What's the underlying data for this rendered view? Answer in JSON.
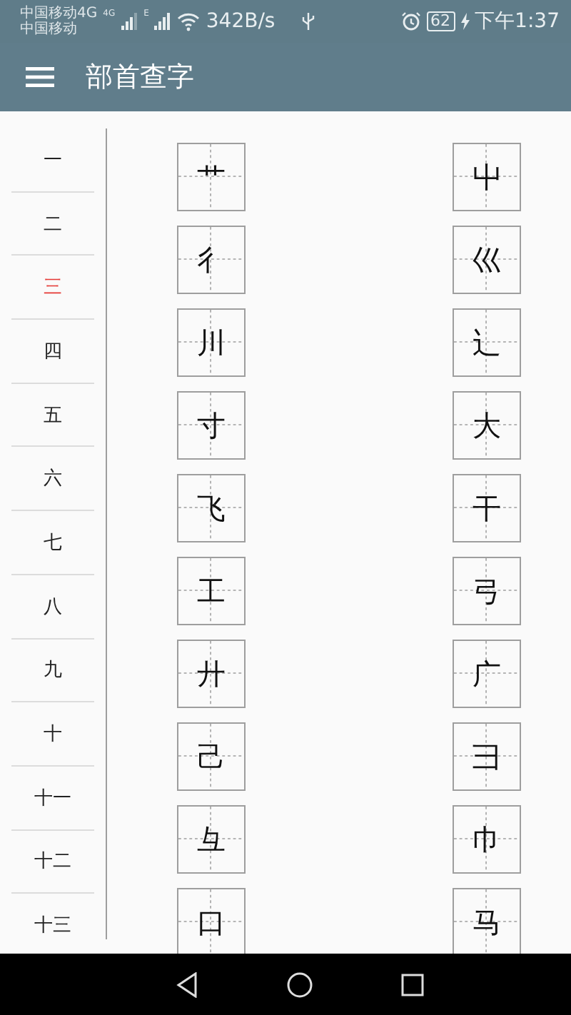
{
  "status_bar": {
    "carriers": [
      "中国移动4G",
      "中国移动"
    ],
    "signal_labels": [
      "4G",
      "E"
    ],
    "speed": "342B/s",
    "battery": "62",
    "time": "下午1:37"
  },
  "app_bar": {
    "title": "部首查字"
  },
  "strokes": [
    {
      "label": "一",
      "selected": false
    },
    {
      "label": "二",
      "selected": false
    },
    {
      "label": "三",
      "selected": true
    },
    {
      "label": "四",
      "selected": false
    },
    {
      "label": "五",
      "selected": false
    },
    {
      "label": "六",
      "selected": false
    },
    {
      "label": "七",
      "selected": false
    },
    {
      "label": "八",
      "selected": false
    },
    {
      "label": "九",
      "selected": false
    },
    {
      "label": "十",
      "selected": false
    },
    {
      "label": "十一",
      "selected": false
    },
    {
      "label": "十二",
      "selected": false
    },
    {
      "label": "十三",
      "selected": false
    }
  ],
  "radicals": [
    "艹",
    "屮",
    "彳",
    "巛",
    "川",
    "辶",
    "寸",
    "大",
    "飞",
    "干",
    "工",
    "弓",
    "廾",
    "广",
    "己",
    "彐",
    "彑",
    "巾",
    "口",
    "马"
  ]
}
